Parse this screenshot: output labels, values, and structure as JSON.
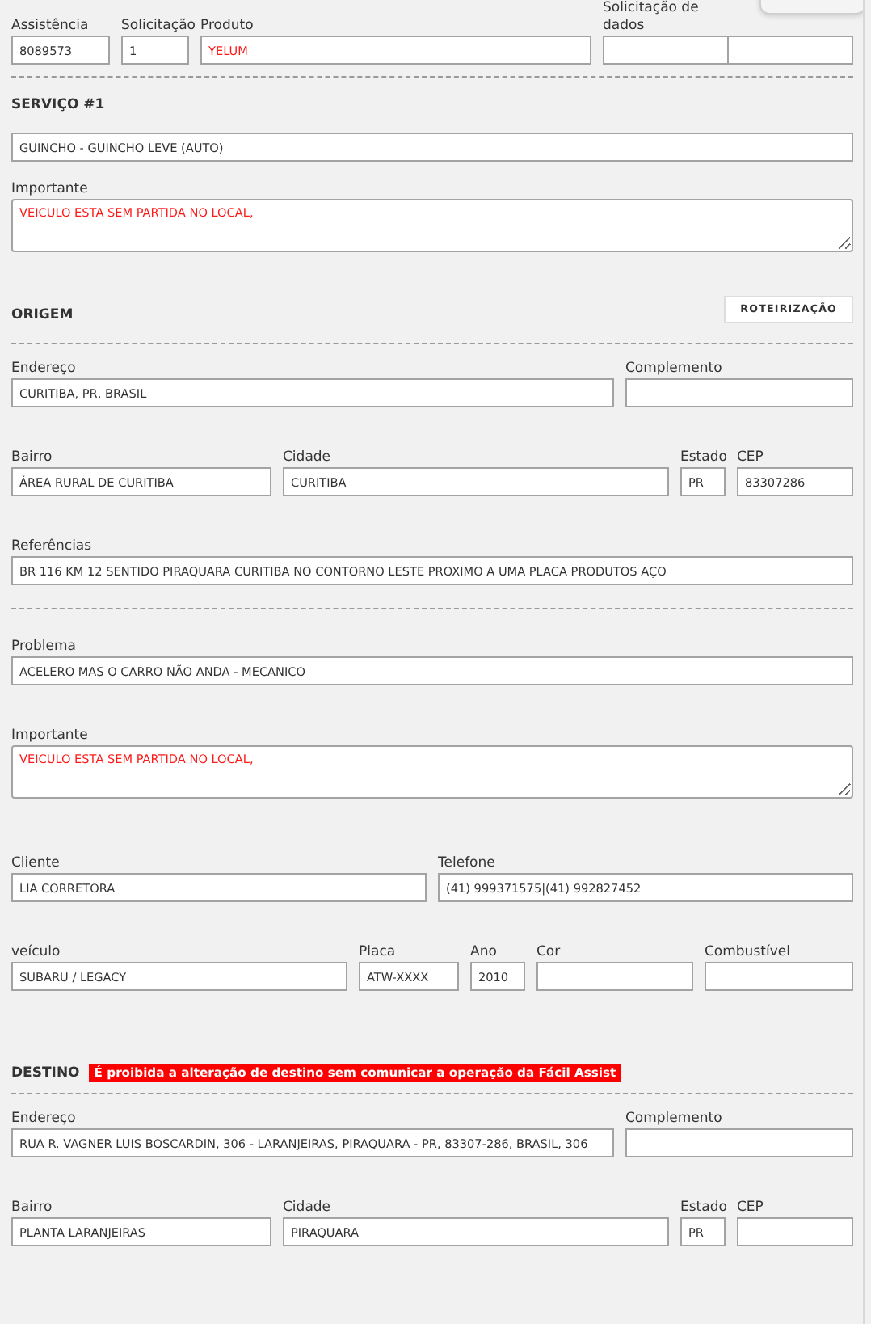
{
  "header": {
    "fields": [
      {
        "label": "Assistência",
        "value": "8089573",
        "kind": "input",
        "alert": false
      },
      {
        "label": "Solicitação",
        "value": "1",
        "kind": "input",
        "alert": false
      },
      {
        "label": "Produto",
        "value": "YELUM",
        "kind": "input",
        "alert": true
      },
      {
        "label": "Solicitação de dados",
        "kind": "split"
      }
    ]
  },
  "service": {
    "title": "SERVIÇO #1",
    "groups": [
      {
        "fields": [
          {
            "value": "GUINCHO - GUINCHO LEVE (AUTO)",
            "kind": "input",
            "alert": false
          }
        ]
      },
      {
        "fields": [
          {
            "label": "Importante",
            "value": "VEICULO ESTA SEM PARTIDA NO LOCAL,",
            "kind": "textarea",
            "alert": true
          }
        ]
      }
    ]
  },
  "origin": {
    "title": "ORIGEM",
    "button": "ROTEIRIZAÇÃO",
    "groups": [
      {
        "fields": [
          {
            "label": "Endereço",
            "value": "CURITIBA, PR, BRASIL",
            "kind": "input",
            "alert": false
          },
          {
            "label": "Complemento",
            "kind": "input"
          }
        ]
      },
      {
        "fields": [
          {
            "label": "Bairro",
            "value": "ÁREA RURAL DE CURITIBA",
            "kind": "input",
            "alert": false
          },
          {
            "label": "Cidade",
            "value": "CURITIBA",
            "kind": "input",
            "alert": false
          },
          {
            "label": "Estado",
            "value": "PR",
            "kind": "input",
            "alert": false
          },
          {
            "label": "CEP",
            "value": "83307286",
            "kind": "input",
            "alert": false
          }
        ]
      },
      {
        "fields": [
          {
            "label": "Referências",
            "value": "BR 116 KM 12 SENTIDO PIRAQUARA CURITIBA NO CONTORNO LESTE PROXIMO A UMA PLACA PRODUTOS AÇO",
            "kind": "input",
            "alert": false
          }
        ]
      }
    ]
  },
  "details": {
    "groups": [
      {
        "fields": [
          {
            "label": "Problema",
            "value": "ACELERO MAS O CARRO NÃO ANDA - MECANICO",
            "kind": "input",
            "alert": false
          }
        ]
      },
      {
        "fields": [
          {
            "label": "Importante",
            "value": "VEICULO ESTA SEM PARTIDA NO LOCAL,",
            "kind": "textarea",
            "alert": true
          }
        ]
      },
      {
        "fields": [
          {
            "label": "Cliente",
            "value": "LIA CORRETORA",
            "kind": "input",
            "alert": false
          },
          {
            "label": "Telefone",
            "value": "(41) 999371575|(41) 992827452",
            "kind": "input",
            "alert": false
          }
        ]
      },
      {
        "fields": [
          {
            "label": "veículo",
            "value": "SUBARU / LEGACY",
            "kind": "input",
            "alert": false
          },
          {
            "label": "Placa",
            "value": "ATW-XXXX",
            "kind": "input",
            "alert": false
          },
          {
            "label": "Ano",
            "value": "2010",
            "kind": "input",
            "alert": false
          },
          {
            "label": "Cor",
            "kind": "input"
          },
          {
            "label": "Combustível",
            "kind": "input"
          }
        ]
      }
    ]
  },
  "destination": {
    "title": "DESTINO",
    "warning": "É proibida a alteração de destino sem comunicar a operação da Fácil Assist",
    "groups": [
      {
        "fields": [
          {
            "label": "Endereço",
            "value": "RUA R. VAGNER LUIS BOSCARDIN, 306 - LARANJEIRAS, PIRAQUARA - PR, 83307-286, BRASIL, 306",
            "kind": "input",
            "alert": false
          },
          {
            "label": "Complemento",
            "kind": "input"
          }
        ]
      },
      {
        "fields": [
          {
            "label": "Bairro",
            "value": "PLANTA LARANJEIRAS",
            "kind": "input",
            "alert": false
          },
          {
            "label": "Cidade",
            "value": "PIRAQUARA",
            "kind": "input",
            "alert": false
          },
          {
            "label": "Estado",
            "value": "PR",
            "kind": "input",
            "alert": false
          },
          {
            "label": "CEP",
            "kind": "input"
          }
        ]
      }
    ]
  }
}
